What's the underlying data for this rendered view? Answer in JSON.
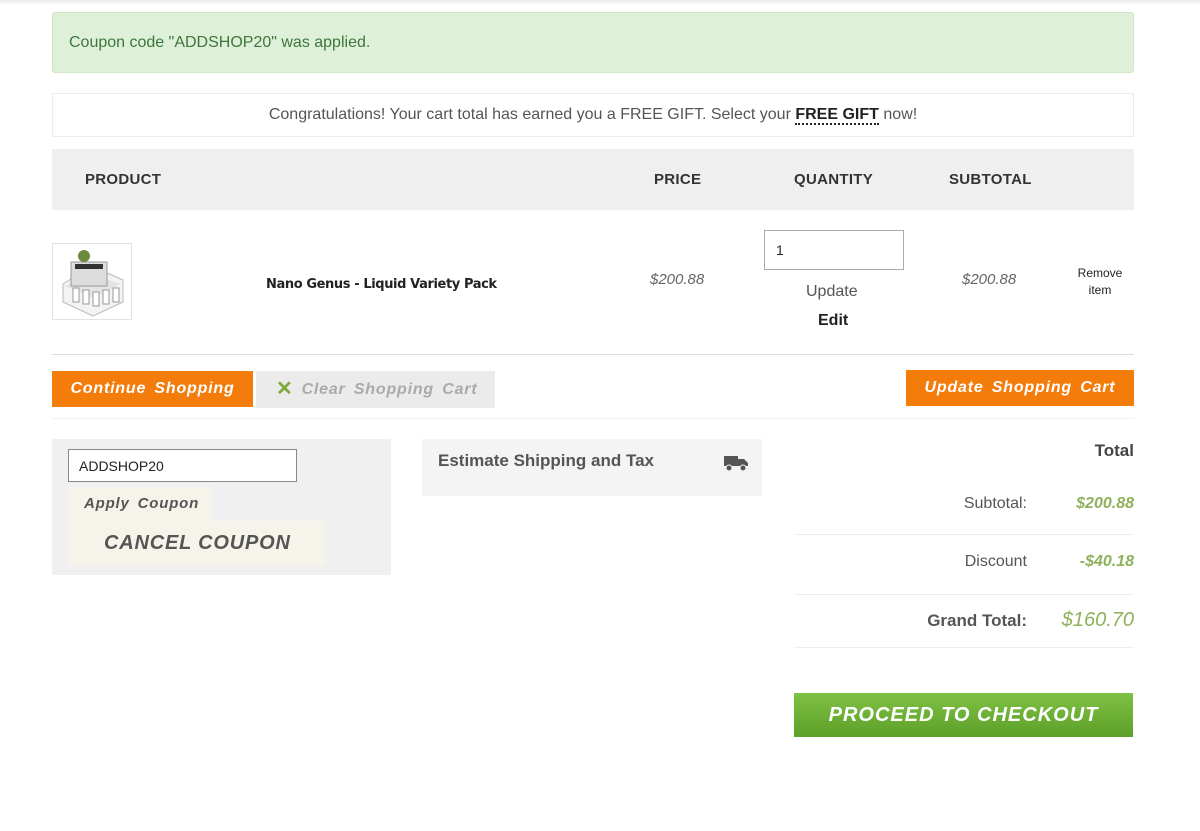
{
  "alert": {
    "message": "Coupon code \"ADDSHOP20\" was applied."
  },
  "gift_banner": {
    "text_before": "Congratulations! Your cart total has earned you a FREE GIFT. Select your ",
    "link": "FREE GIFT",
    "text_after": " now!"
  },
  "table": {
    "headers": {
      "product": "PRODUCT",
      "price": "PRICE",
      "quantity": "QUANTITY",
      "subtotal": "SUBTOTAL"
    }
  },
  "item": {
    "name": "Nano Genus - Liquid Variety Pack",
    "price": "$200.88",
    "quantity": "1",
    "subtotal": "$200.88",
    "update_label": "Update",
    "edit_label": "Edit",
    "remove_label": "Remove item"
  },
  "actions": {
    "continue": "Continue Shopping",
    "clear": "Clear Shopping Cart",
    "update_cart": "Update Shopping Cart"
  },
  "coupon": {
    "code": "ADDSHOP20",
    "apply_label": "Apply Coupon",
    "cancel_label": "CANCEL COUPON"
  },
  "shipping": {
    "title": "Estimate Shipping and Tax"
  },
  "totals": {
    "title": "Total",
    "subtotal_label": "Subtotal:",
    "subtotal_value": "$200.88",
    "discount_label": "Discount",
    "discount_value": "-$40.18",
    "grand_label": "Grand Total:",
    "grand_value": "$160.70"
  },
  "checkout": {
    "label": "PROCEED TO CHECKOUT"
  },
  "colors": {
    "accent_orange": "#f47c0a",
    "accent_green": "#6db233",
    "success_bg": "#dff0d8"
  }
}
